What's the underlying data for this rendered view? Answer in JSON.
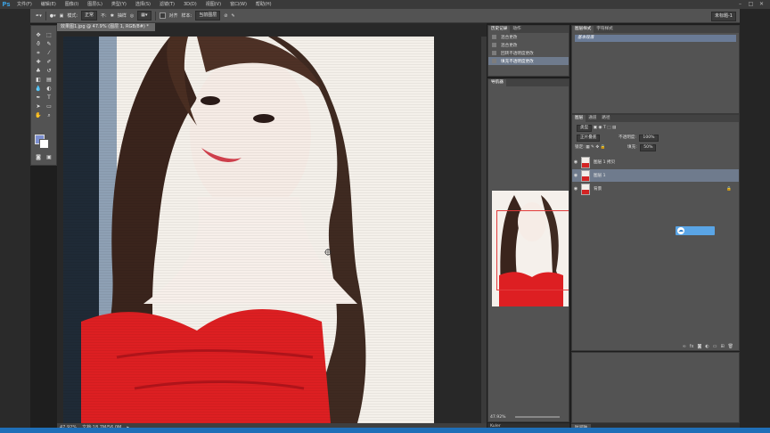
{
  "app": {
    "logo": "Ps"
  },
  "menu": [
    "文件(F)",
    "编辑(E)",
    "图像(I)",
    "图层(L)",
    "类型(Y)",
    "选择(S)",
    "滤镜(T)",
    "3D(D)",
    "视图(V)",
    "窗口(W)",
    "帮助(H)"
  ],
  "options_bar": {
    "mode_label": "模式:",
    "mode_value": "正常",
    "opacity_label": "不:",
    "smooth_label": "抽样",
    "align_label": "对齐",
    "sample_label": "样本:",
    "sample_value": "当前图层",
    "workspace": "未标题-1"
  },
  "document": {
    "tab_title": "效果图1.jpg @ 47.9% (图层 1, RGB/8#) *",
    "zoom": "47.92%",
    "file_info": "文档:18.7M/56.0M"
  },
  "history_panel": {
    "tabs": [
      "历史记录",
      "动作"
    ],
    "items": [
      "混合更改",
      "混合更改",
      "回转不透明度更改",
      "填充不透明度更改"
    ],
    "selected_index": 3
  },
  "navigator": {
    "tab": "导航器",
    "zoom": "47.92%"
  },
  "styles_panel": {
    "tabs": [
      "图层样式",
      "字符样式"
    ],
    "item": "基本段落"
  },
  "layers_panel": {
    "tabs": [
      "图层",
      "通道",
      "路径"
    ],
    "kind_label": "类型",
    "blend_mode": "正片叠底",
    "opacity_label": "不透明度:",
    "opacity_value": "100%",
    "lock_label": "锁定:",
    "fill_label": "填充:",
    "fill_value": "50%",
    "layers": [
      {
        "name": "图层 1 拷贝",
        "selected": false
      },
      {
        "name": "图层 1",
        "selected": true
      },
      {
        "name": "背景",
        "selected": false,
        "locked": true
      }
    ]
  },
  "bottom_tabs": {
    "nav": "Kuler",
    "right": "时间轴"
  }
}
